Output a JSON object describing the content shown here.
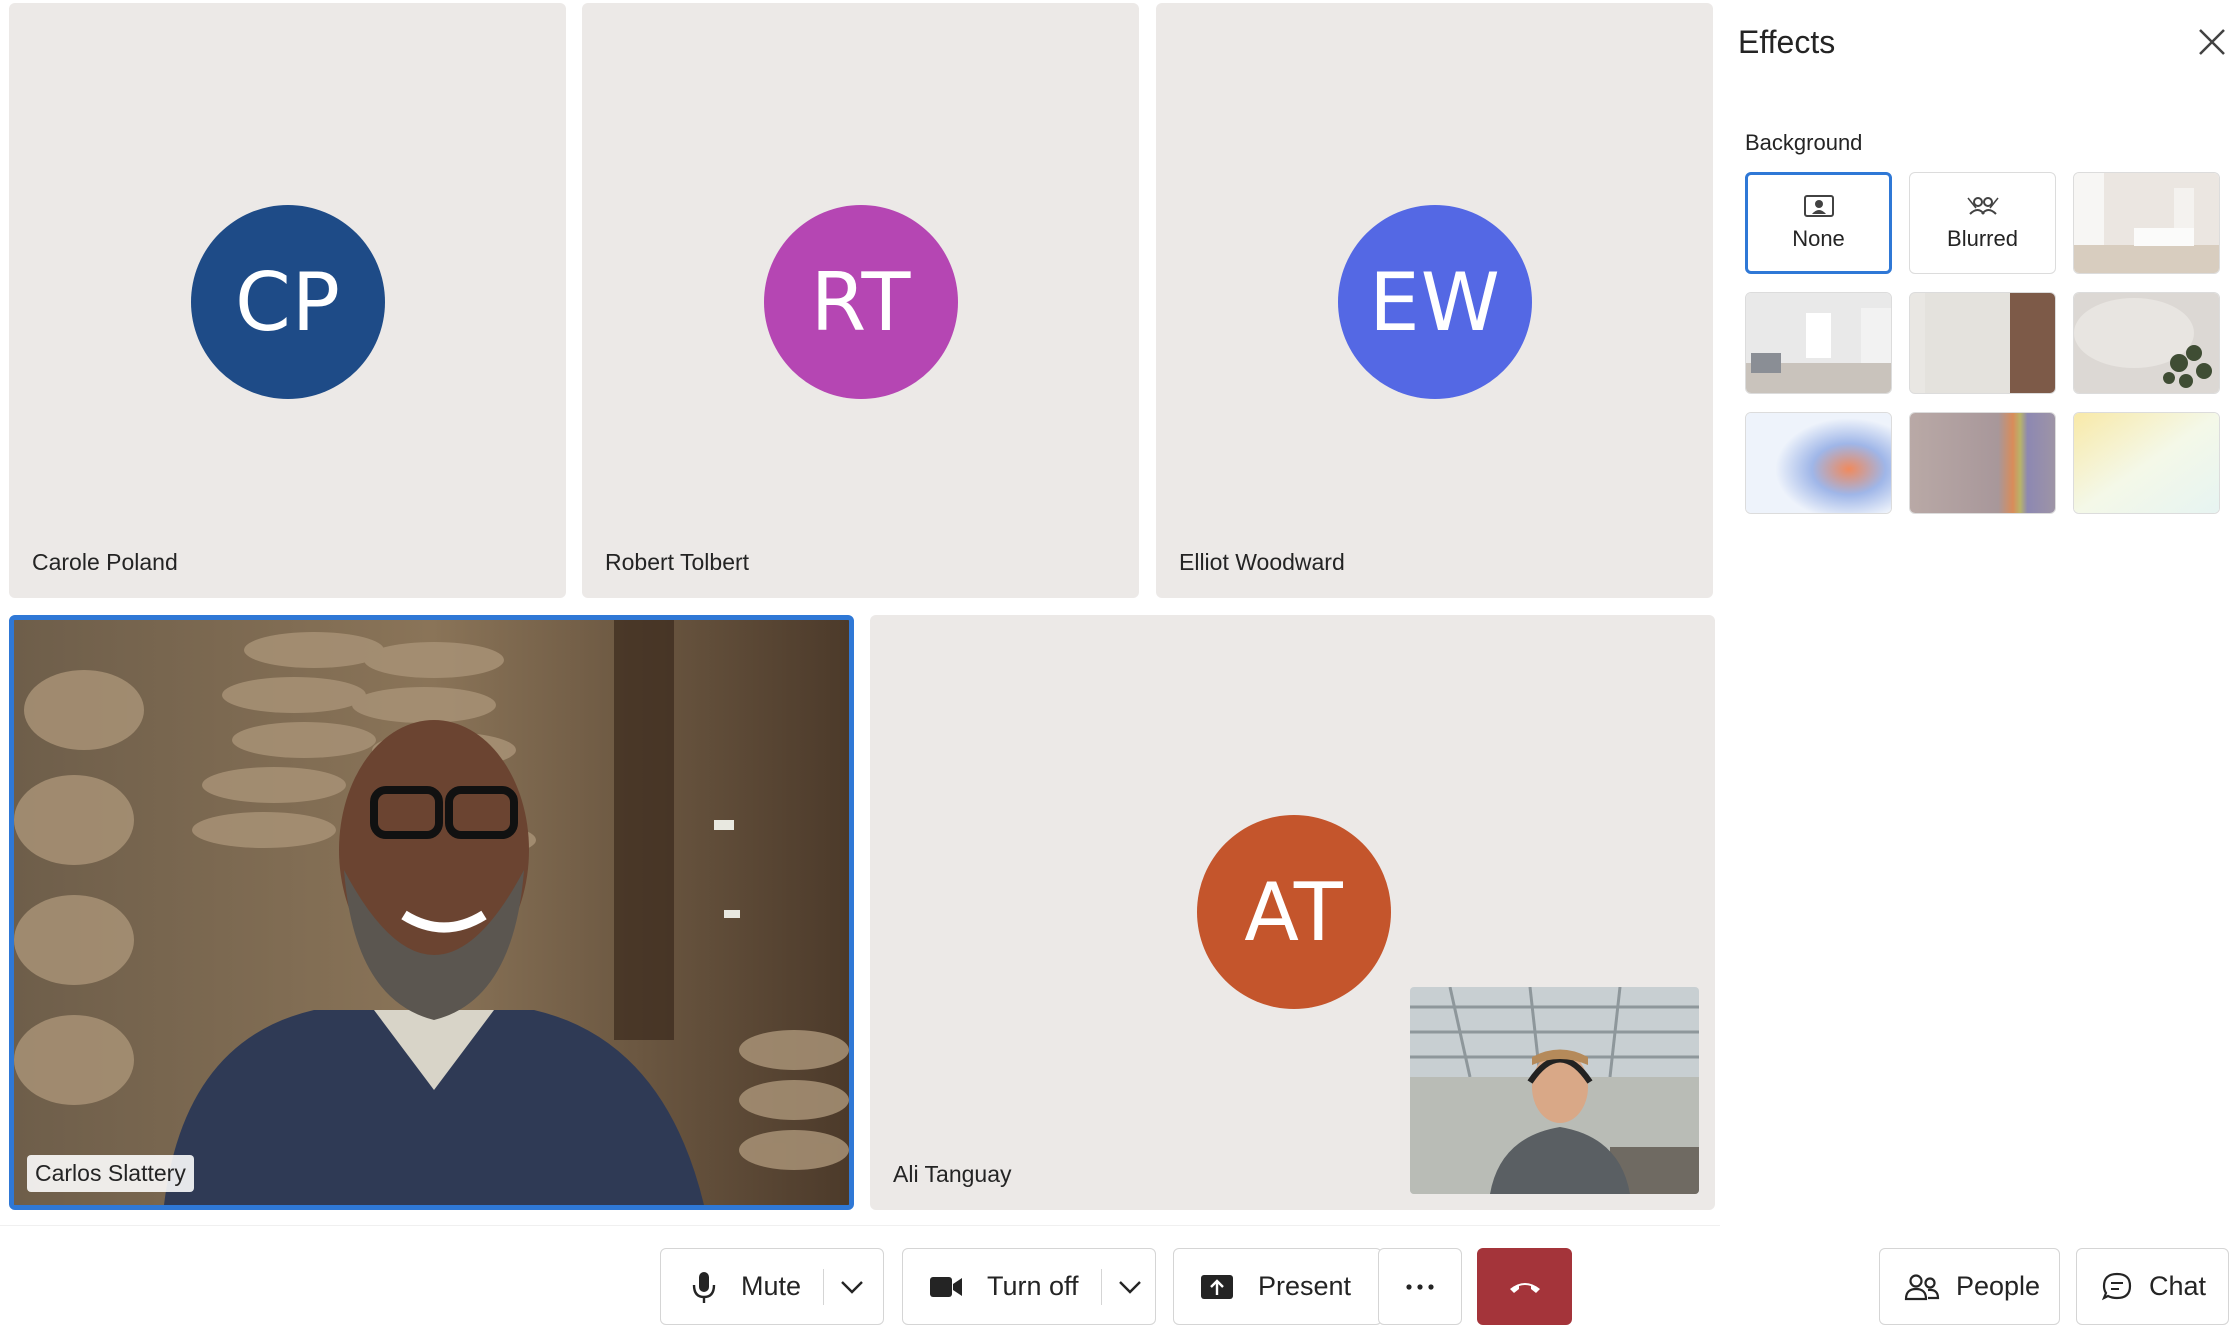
{
  "participants": [
    {
      "name": "Carole Poland",
      "initials": "CP",
      "color": "#1e4b87"
    },
    {
      "name": "Robert Tolbert",
      "initials": "RT",
      "color": "#b546b3"
    },
    {
      "name": "Elliot Woodward",
      "initials": "EW",
      "color": "#5468e4"
    },
    {
      "name": "Carlos Slattery",
      "initials": "",
      "color": "#2f78d6"
    },
    {
      "name": "Ali Tanguay",
      "initials": "AT",
      "color": "#c4552c"
    }
  ],
  "effects_panel": {
    "title": "Effects",
    "section_label": "Background",
    "options": [
      {
        "label": "None",
        "icon": "person-frame-icon",
        "selected": true
      },
      {
        "label": "Blurred",
        "icon": "blur-person-icon",
        "selected": false
      },
      {
        "label": "",
        "icon": "bedroom-image"
      },
      {
        "label": "",
        "icon": "living-room-image"
      },
      {
        "label": "",
        "icon": "bathroom-mirror-image"
      },
      {
        "label": "",
        "icon": "plant-wall-image"
      },
      {
        "label": "",
        "icon": "blue-gradient-image"
      },
      {
        "label": "",
        "icon": "rainbow-image"
      },
      {
        "label": "",
        "icon": "pastel-gradient-image"
      }
    ]
  },
  "toolbar": {
    "mute_label": "Mute",
    "camera_label": "Turn off",
    "present_label": "Present",
    "more_label": "···",
    "people_label": "People",
    "chat_label": "Chat"
  },
  "colors": {
    "accent": "#2f78d6",
    "hangup": "#a4343a",
    "tile_bg": "#ece9e7"
  }
}
